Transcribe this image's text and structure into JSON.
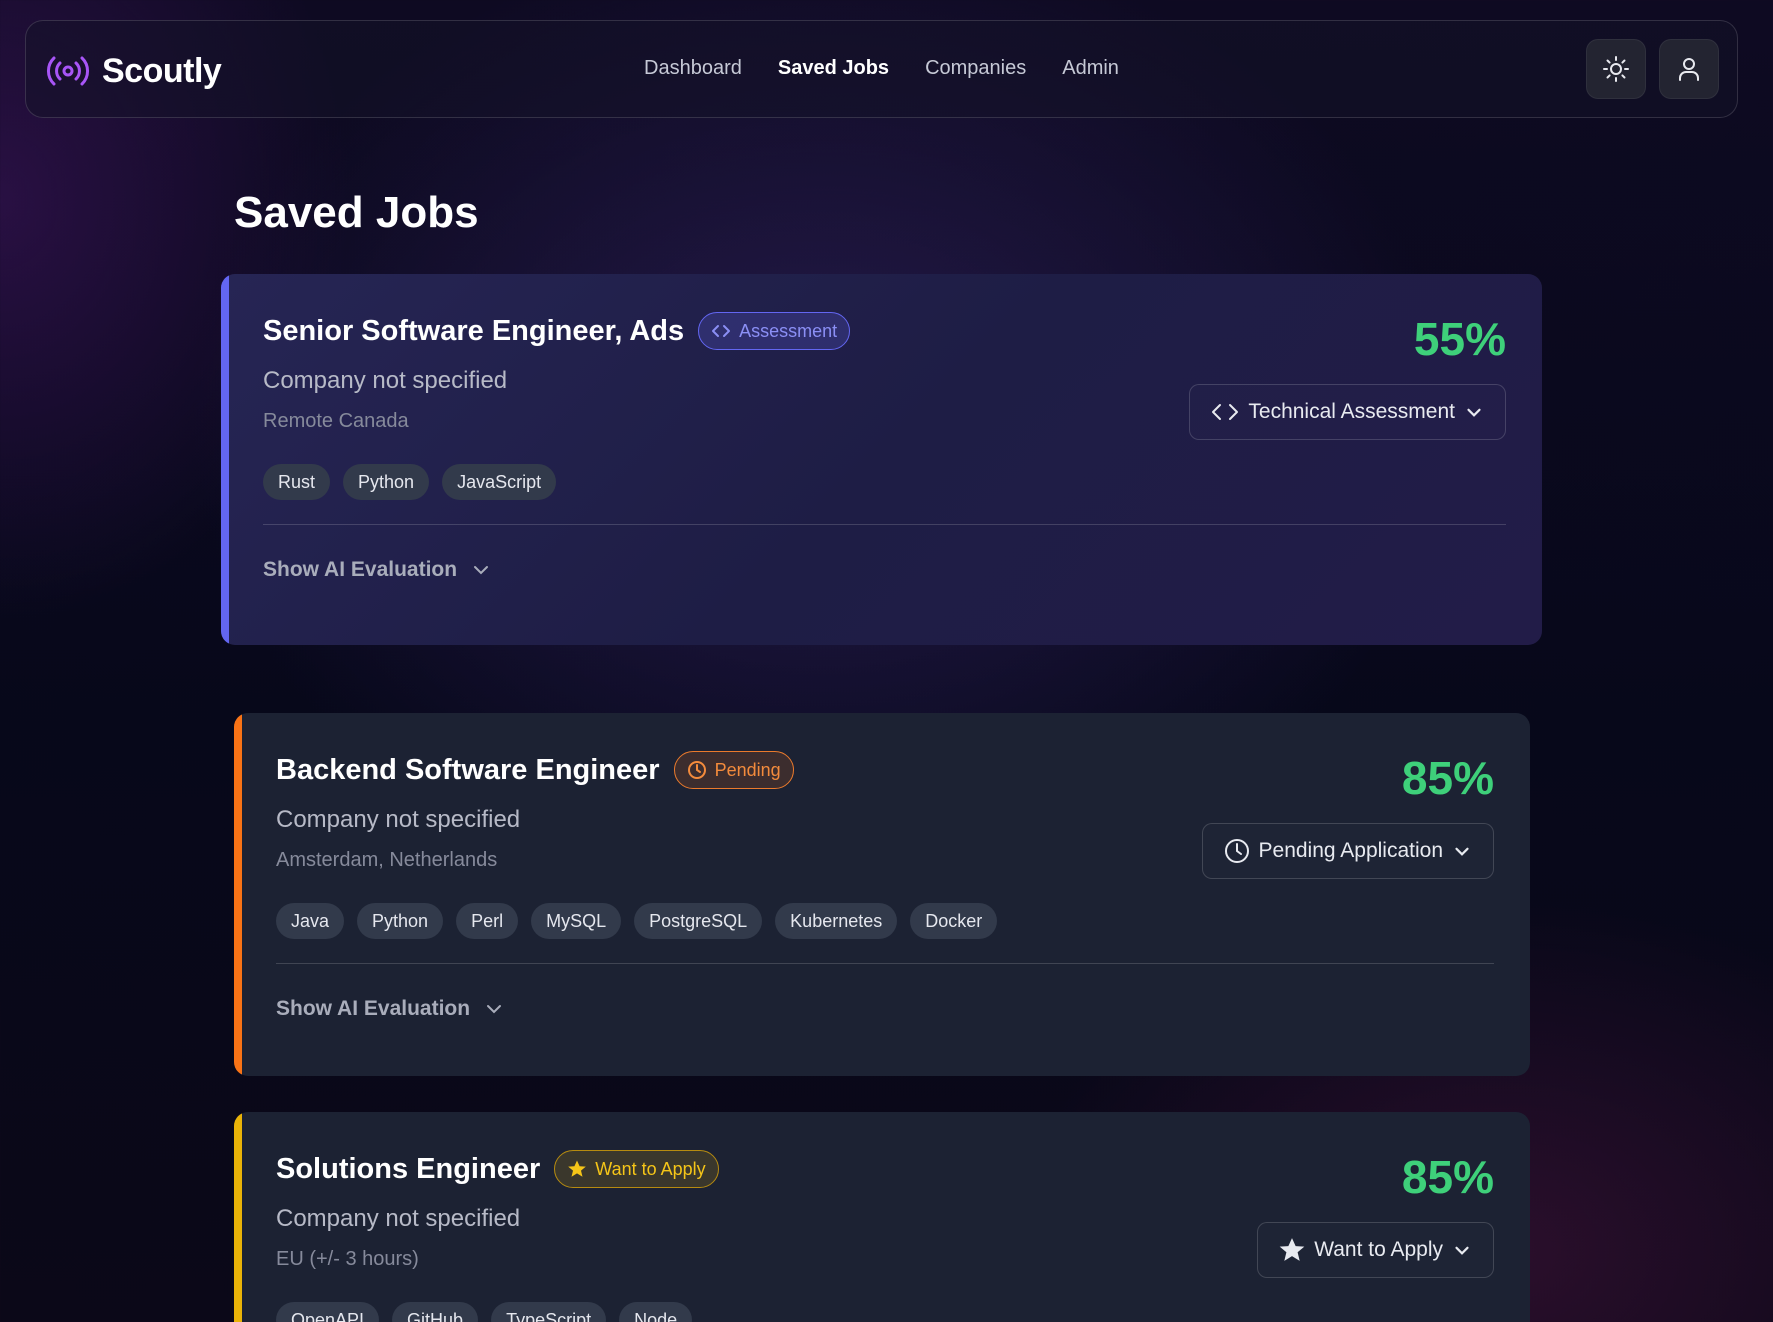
{
  "brand": {
    "name": "Scoutly",
    "icon": "radio-broadcast-icon",
    "accent": "#a855f7"
  },
  "nav": {
    "links": [
      {
        "label": "Dashboard",
        "active": false
      },
      {
        "label": "Saved Jobs",
        "active": true
      },
      {
        "label": "Companies",
        "active": false
      },
      {
        "label": "Admin",
        "active": false
      }
    ],
    "actions": [
      "sun-icon",
      "user-icon"
    ]
  },
  "page": {
    "title": "Saved Jobs"
  },
  "jobs": [
    {
      "title": "Senior Software Engineer, Ads",
      "badge": {
        "label": "Assessment",
        "icon": "code-icon",
        "color": "#6366f1"
      },
      "company": "Company not specified",
      "location": "Remote Canada",
      "tags": [
        "Rust",
        "Python",
        "JavaScript"
      ],
      "score": "55%",
      "status": "Technical Assessment",
      "eval_toggle": "Show AI Evaluation",
      "accent": "#6366f1"
    },
    {
      "title": "Backend Software Engineer",
      "badge": {
        "label": "Pending",
        "icon": "clock-icon",
        "color": "#f97316"
      },
      "company": "Company not specified",
      "location": "Amsterdam, Netherlands",
      "tags": [
        "Java",
        "Python",
        "Perl",
        "MySQL",
        "PostgreSQL",
        "Kubernetes",
        "Docker"
      ],
      "score": "85%",
      "status": "Pending Application",
      "eval_toggle": "Show AI Evaluation",
      "accent": "#f97316"
    },
    {
      "title": "Solutions Engineer",
      "badge": {
        "label": "Want to Apply",
        "icon": "star-icon",
        "color": "#eab308"
      },
      "company": "Company not specified",
      "location": "EU (+/- 3 hours)",
      "tags": [
        "OpenAPI",
        "GitHub",
        "TypeScript",
        "Node"
      ],
      "score": "85%",
      "status": "Want to Apply",
      "accent": "#eab308"
    }
  ],
  "colors": {
    "score": "#3ed07a",
    "card": "#1c2233"
  }
}
